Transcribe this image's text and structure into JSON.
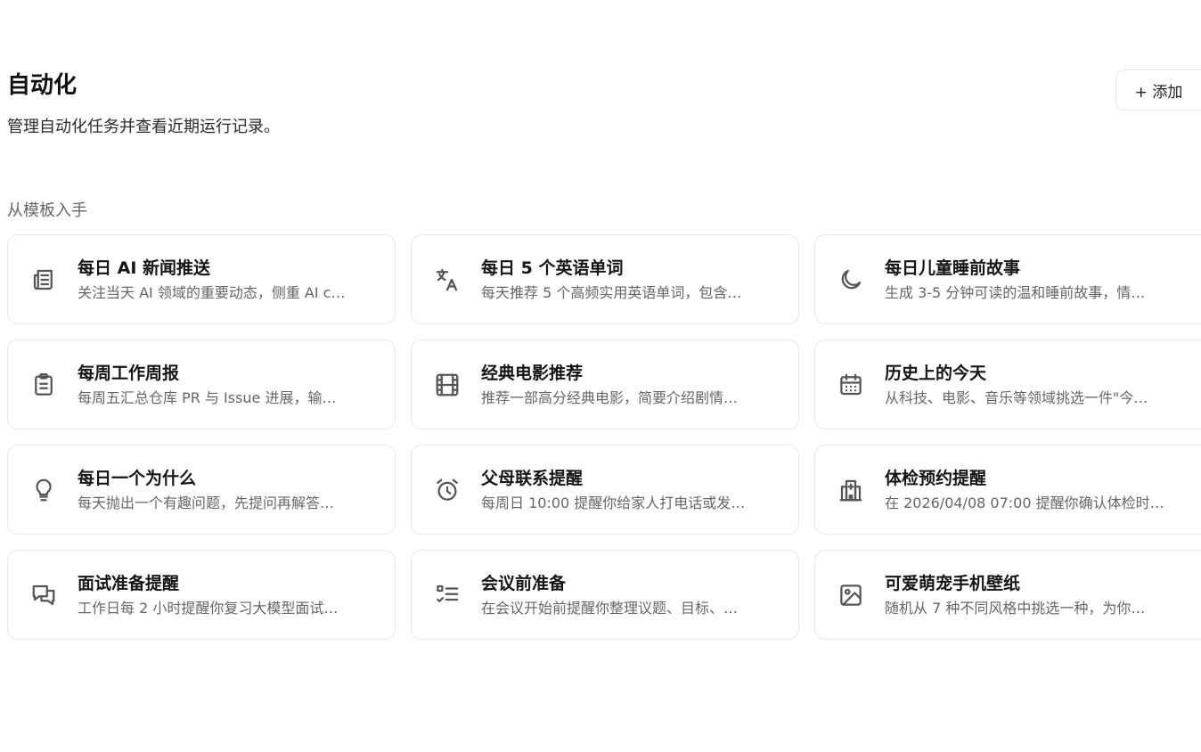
{
  "header": {
    "title": "自动化",
    "subtitle": "管理自动化任务并查看近期运行记录。",
    "add_button_label": "+ 添加"
  },
  "templates": {
    "section_label": "从模板入手",
    "items": [
      {
        "icon": "newspaper-icon",
        "title": "每日 AI 新闻推送",
        "desc": "关注当天 AI 领域的重要动态，侧重 AI c…"
      },
      {
        "icon": "translate-icon",
        "title": "每日 5 个英语单词",
        "desc": "每天推荐 5 个高频实用英语单词，包含…"
      },
      {
        "icon": "moon-icon",
        "title": "每日儿童睡前故事",
        "desc": "生成 3-5 分钟可读的温和睡前故事，情…"
      },
      {
        "icon": "clipboard-icon",
        "title": "每周工作周报",
        "desc": "每周五汇总仓库 PR 与 Issue 进展，输…"
      },
      {
        "icon": "film-icon",
        "title": "经典电影推荐",
        "desc": "推荐一部高分经典电影，简要介绍剧情…"
      },
      {
        "icon": "calendar-icon",
        "title": "历史上的今天",
        "desc": "从科技、电影、音乐等领域挑选一件\"今…"
      },
      {
        "icon": "lightbulb-icon",
        "title": "每日一个为什么",
        "desc": "每天抛出一个有趣问题，先提问再解答…"
      },
      {
        "icon": "alarm-clock-icon",
        "title": "父母联系提醒",
        "desc": "每周日 10:00 提醒你给家人打电话或发…"
      },
      {
        "icon": "hospital-icon",
        "title": "体检预约提醒",
        "desc": "在 2026/04/08 07:00 提醒你确认体检时…"
      },
      {
        "icon": "chat-bubbles-icon",
        "title": "面试准备提醒",
        "desc": "工作日每 2 小时提醒你复习大模型面试…"
      },
      {
        "icon": "checklist-icon",
        "title": "会议前准备",
        "desc": "在会议开始前提醒你整理议题、目标、…"
      },
      {
        "icon": "image-icon",
        "title": "可爱萌宠手机壁纸",
        "desc": "随机从 7 种不同风格中挑选一种，为你…"
      }
    ]
  }
}
